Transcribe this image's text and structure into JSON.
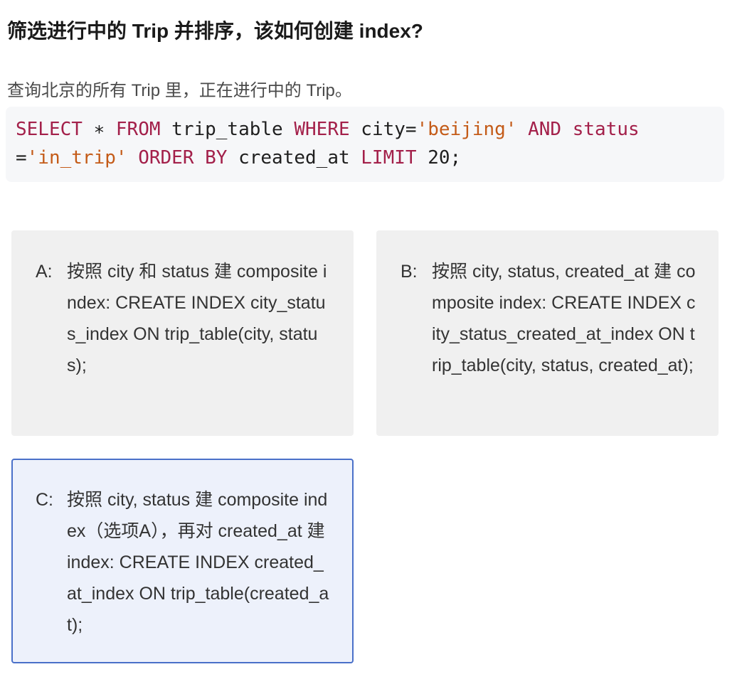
{
  "question": {
    "title": "筛选进行中的 Trip 并排序，该如何创建 index?",
    "description": "查询北京的所有 Trip 里，正在进行中的 Trip。"
  },
  "code": {
    "line1": [
      {
        "t": "SELECT",
        "k": "kw"
      },
      {
        "t": " ∗ ",
        "k": "plain"
      },
      {
        "t": "FROM",
        "k": "kw"
      },
      {
        "t": " trip_table ",
        "k": "plain"
      },
      {
        "t": "WHERE",
        "k": "kw"
      },
      {
        "t": " city=",
        "k": "plain"
      },
      {
        "t": "'beijing'",
        "k": "str"
      },
      {
        "t": " ",
        "k": "plain"
      },
      {
        "t": "AND",
        "k": "kw"
      },
      {
        "t": " ",
        "k": "plain"
      },
      {
        "t": "status",
        "k": "kw"
      }
    ],
    "line2": [
      {
        "t": "=",
        "k": "plain"
      },
      {
        "t": "'in_trip'",
        "k": "str"
      },
      {
        "t": " ",
        "k": "plain"
      },
      {
        "t": "ORDER BY",
        "k": "kw"
      },
      {
        "t": " created_at ",
        "k": "plain"
      },
      {
        "t": "LIMIT",
        "k": "kw"
      },
      {
        "t": " 20;",
        "k": "plain"
      }
    ]
  },
  "options": [
    {
      "letter": "A:",
      "text": "按照 city 和 status 建 composite index: CREATE INDEX city_status_index ON trip_table(city, status);"
    },
    {
      "letter": "B:",
      "text": "按照 city, status, created_at 建 composite index: CREATE INDEX city_status_created_at_index ON trip_table(city, status, created_at);"
    },
    {
      "letter": "C:",
      "text": "按照 city, status 建 composite index（选项A），再对 created_at 建 index: CREATE INDEX created_at_index ON trip_table(created_at);"
    }
  ],
  "selected_option": "C",
  "colors": {
    "keyword": "#a3204a",
    "string": "#c45b18",
    "selected_border": "#4a70c9",
    "selected_bg": "#edf1fb",
    "option_bg": "#f0f0f0"
  }
}
